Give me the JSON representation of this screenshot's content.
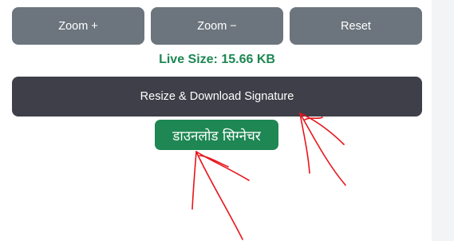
{
  "controls": {
    "zoom_in_label": "Zoom +",
    "zoom_out_label": "Zoom −",
    "reset_label": "Reset"
  },
  "live_size": {
    "text": "Live Size: 15.66 KB"
  },
  "actions": {
    "resize_download_label": "Resize & Download Signature",
    "download_hindi_label": "डाउनलोड सिग्नेचर"
  },
  "colors": {
    "gray_button": "#6c757d",
    "dark_button": "#3e3f48",
    "accent_green": "#1e8753",
    "annotation_red": "#e8141b"
  }
}
